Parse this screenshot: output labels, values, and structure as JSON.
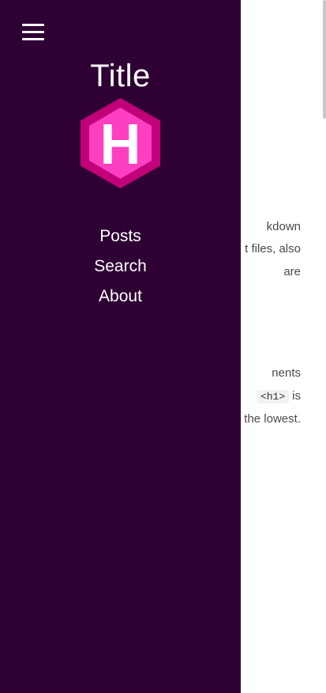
{
  "article": {
    "line1": "kdown",
    "line2": "t files, also",
    "line3": "are",
    "line4": "nents",
    "line5_code": "<h1>",
    "line5_text": "is",
    "line6": "the lowest."
  },
  "drawer": {
    "title": "Title",
    "logo_letter": "H",
    "nav_items": [
      "Posts",
      "Search",
      "About"
    ]
  },
  "colors": {
    "drawer_bg": "#2e0033",
    "logo_outer": "#c2007a",
    "logo_inner": "#ff3fc1",
    "text": "#ffffff"
  },
  "icons": {
    "menu": "hamburger-menu-icon",
    "logo": "hexagon-logo-icon"
  }
}
